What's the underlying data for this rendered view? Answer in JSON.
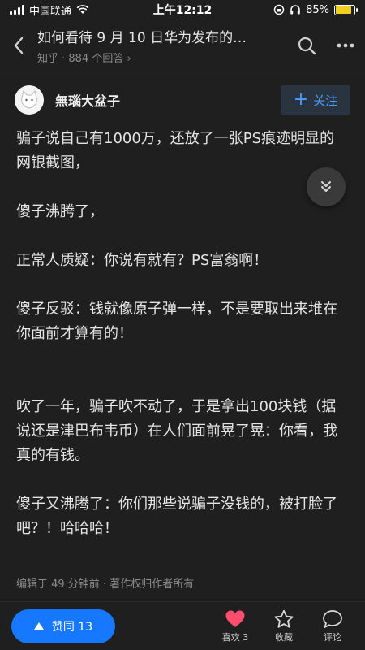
{
  "status_bar": {
    "carrier": "中国联通",
    "time": "上午12:12",
    "battery": "85%",
    "battery_level": 0.85
  },
  "header": {
    "question_title": "如何看待 9 月 10 日华为发布的…",
    "subtitle": "知乎 · 884 个回答 ›"
  },
  "author": {
    "name": "無瑙大盆子",
    "follow_label": "关注"
  },
  "content": {
    "p1": "骗子说自己有1000万，还放了一张PS痕迹明显的网银截图，",
    "p2": "傻子沸腾了，",
    "p3": "正常人质疑：你说有就有？PS富翁啊！",
    "p4": "傻子反驳：钱就像原子弹一样，不是要取出来堆在你面前才算有的！",
    "p5": "吹了一年，骗子吹不动了，于是拿出100块钱（据说还是津巴布韦币）在人们面前晃了晃：你看，我真的有钱。",
    "p6": "傻子又沸腾了：你们那些说骗子没钱的，被打脸了吧？！哈哈哈！"
  },
  "meta": "编辑于 49 分钟前 · 著作权归作者所有",
  "bottom_bar": {
    "upvote_label": "赞同 13",
    "like_label": "喜欢 3",
    "collect_label": "收藏",
    "comment_label": "评论"
  },
  "colors": {
    "accent": "#1677ff",
    "like": "#ff4d6d",
    "background": "#1f1f1f"
  }
}
